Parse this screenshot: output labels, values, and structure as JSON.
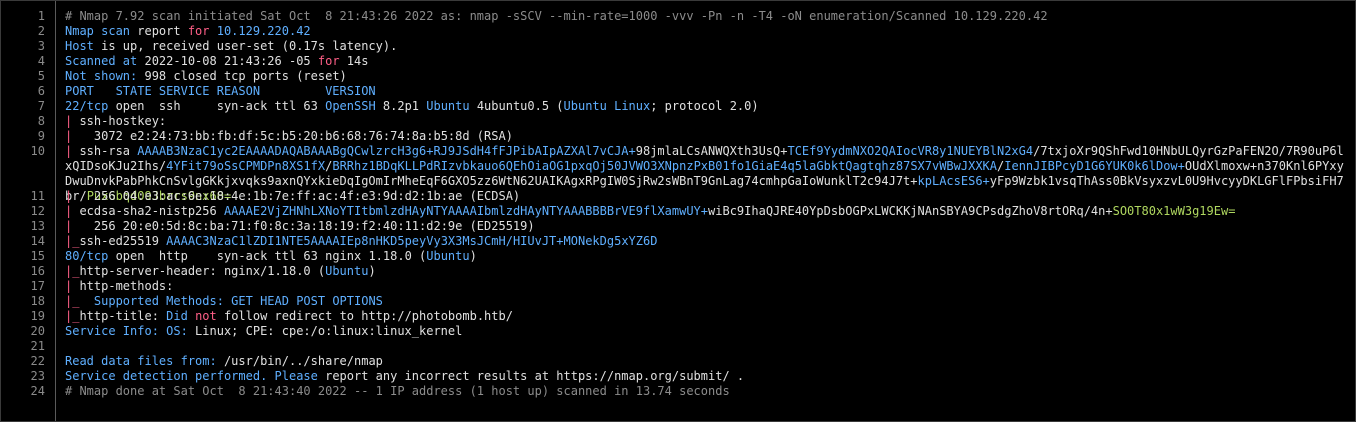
{
  "editor": {
    "lines": [
      {
        "num": "1",
        "segments": [
          {
            "text": "# Nmap 7.92 scan initiated Sat Oct  8 21:43:26 2022 as: nmap -sSCV --min-rate=1000 -vvv -Pn -n -T4 -oN enumeration/Scanned 10.129.220.42",
            "color": "#8c8c8c"
          }
        ]
      },
      {
        "num": "2",
        "segments": [
          {
            "text": "Nmap scan ",
            "color": "#5fafff"
          },
          {
            "text": "report ",
            "color": "#e0e0e0"
          },
          {
            "text": "for ",
            "color": "#ff5f87"
          },
          {
            "text": "10.129.220.42",
            "color": "#5fafff"
          }
        ]
      },
      {
        "num": "3",
        "segments": [
          {
            "text": "Host ",
            "color": "#5fafff"
          },
          {
            "text": "is up, received user-set (0.17s latency).",
            "color": "#e0e0e0"
          }
        ]
      },
      {
        "num": "4",
        "segments": [
          {
            "text": "Scanned at ",
            "color": "#5fafff"
          },
          {
            "text": "2022-10-08 21:43:26 -05 ",
            "color": "#e0e0e0"
          },
          {
            "text": "for ",
            "color": "#ff5f87"
          },
          {
            "text": "14s",
            "color": "#e0e0e0"
          }
        ]
      },
      {
        "num": "5",
        "segments": [
          {
            "text": "Not shown: ",
            "color": "#5fafff"
          },
          {
            "text": "998 closed tcp ports (reset)",
            "color": "#e0e0e0"
          }
        ]
      },
      {
        "num": "6",
        "segments": [
          {
            "text": "PORT   STATE SERVICE REASON         VERSION",
            "color": "#5fafff"
          }
        ]
      },
      {
        "num": "7",
        "segments": [
          {
            "text": "22/tcp ",
            "color": "#5fafff"
          },
          {
            "text": "open  ssh     syn-ack ttl 63 ",
            "color": "#e0e0e0"
          },
          {
            "text": "OpenSSH ",
            "color": "#5fafff"
          },
          {
            "text": "8.2p1 ",
            "color": "#e0e0e0"
          },
          {
            "text": "Ubuntu ",
            "color": "#5fafff"
          },
          {
            "text": "4ubuntu0.5 (",
            "color": "#e0e0e0"
          },
          {
            "text": "Ubuntu Linux",
            "color": "#5fafff"
          },
          {
            "text": "; protocol 2.0)",
            "color": "#e0e0e0"
          }
        ]
      },
      {
        "num": "8",
        "segments": [
          {
            "text": "| ",
            "color": "#ff5f87"
          },
          {
            "text": "ssh-hostkey:",
            "color": "#e0e0e0"
          }
        ]
      },
      {
        "num": "9",
        "segments": [
          {
            "text": "|   ",
            "color": "#ff5f87"
          },
          {
            "text": "3072 e2:24:73:bb:fb:df:5c:b5:20:b6:68:76:74:8a:b5:8d (RSA)",
            "color": "#e0e0e0"
          }
        ]
      },
      {
        "num": "10",
        "wrap": true,
        "segments": [
          {
            "text": "| ",
            "color": "#ff5f87"
          },
          {
            "text": "ssh-rsa ",
            "color": "#e0e0e0"
          },
          {
            "text": "AAAAB3NzaC1yc2EAAAADAQABAAABgQCwlzrcH3g6+RJ9JSdH4fFJPibAIpAZXAl7vCJA+",
            "color": "#5fafff"
          },
          {
            "text": "98jmlaLCsANWQXth3UsQ+",
            "color": "#e0e0e0"
          },
          {
            "text": "TCEf9YydmNXO2QAIocVR8y1NUEYBlN2xG4",
            "color": "#5fafff"
          },
          {
            "text": "/7txjoXr9QShFwd10HNbULQyrGzPaFEN2O/7R90uP6lxQIDsoKJu2Ihs/",
            "color": "#e0e0e0"
          },
          {
            "text": "4YFit79oSsCPMDPn8XS1fX",
            "color": "#5fafff"
          },
          {
            "text": "/",
            "color": "#e0e0e0"
          },
          {
            "text": "BRRhz1BDqKLLPdRIzvbkauo6QEhOiaOG1pxqOj50JVWO3XNpnzPxB01fo1GiaE4q5laGbktQagtqhz87SX7vWBwJXXKA",
            "color": "#5fafff"
          },
          {
            "text": "/",
            "color": "#e0e0e0"
          },
          {
            "text": "IennJIBPcyD1G6YUK0k6lDow+",
            "color": "#5fafff"
          },
          {
            "text": "OUdXlmoxw+n370Knl6PYxyDwuDnvkPabPhkCnSvlgGKkjxvqks9axnQYxkieDqIgOmIrMheEqF6GXO5zz6WtN62UAIKAgxRPgIW0SjRw2sWBnT9GnLag74cmhpGaIoWunklT2c94J7t+",
            "color": "#e0e0e0"
          },
          {
            "text": "kpLAcsES6+",
            "color": "#5fafff"
          },
          {
            "text": "yFp9Wzbk1vsqThAss0BkVsyxzvL0U9HvcyyDKLGFlFPbsiFH7br/",
            "color": "#e0e0e0"
          },
          {
            "text": "PuxGbqdO9Jbrrs9nx60=",
            "color": "#afd75f"
          }
        ]
      },
      {
        "num": "11",
        "segments": [
          {
            "text": "|   ",
            "color": "#ff5f87"
          },
          {
            "text": "256 04:e3:ac:6e:18:4e:1b:7e:ff:ac:4f:e3:9d:d2:1b:ae (ECDSA)",
            "color": "#e0e0e0"
          }
        ]
      },
      {
        "num": "12",
        "segments": [
          {
            "text": "| ",
            "color": "#ff5f87"
          },
          {
            "text": "ecdsa-sha2-nistp256 ",
            "color": "#e0e0e0"
          },
          {
            "text": "AAAAE2VjZHNhLXNoYTItbmlzdHAyNTYAAAAIbmlzdHAyNTYAAABBBBrVE9flXamwUY+",
            "color": "#5fafff"
          },
          {
            "text": "wiBc9IhaQJRE40YpDsbOGPxLWCKKjNAnSBYA9CPsdgZhoV8rtORq/4n+",
            "color": "#e0e0e0"
          },
          {
            "text": "SO0T80x1wW3g19Ew=",
            "color": "#afd75f"
          }
        ]
      },
      {
        "num": "13",
        "segments": [
          {
            "text": "|   ",
            "color": "#ff5f87"
          },
          {
            "text": "256 20:e0:5d:8c:ba:71:f0:8c:3a:18:19:f2:40:11:d2:9e (ED25519)",
            "color": "#e0e0e0"
          }
        ]
      },
      {
        "num": "14",
        "segments": [
          {
            "text": "|_",
            "color": "#ff5f87"
          },
          {
            "text": "ssh-ed25519 ",
            "color": "#e0e0e0"
          },
          {
            "text": "AAAAC3NzaC1lZDI1NTE5AAAAIEp8nHKD5peyVy3X3MsJCmH/HIUvJT+",
            "color": "#5fafff"
          },
          {
            "text": "MONekDg5xYZ6D",
            "color": "#5fafff"
          }
        ]
      },
      {
        "num": "15",
        "segments": [
          {
            "text": "80/tcp ",
            "color": "#5fafff"
          },
          {
            "text": "open  http    syn-ack ttl 63 nginx 1.18.0 (",
            "color": "#e0e0e0"
          },
          {
            "text": "Ubuntu",
            "color": "#5fafff"
          },
          {
            "text": ")",
            "color": "#e0e0e0"
          }
        ]
      },
      {
        "num": "16",
        "segments": [
          {
            "text": "|_",
            "color": "#ff5f87"
          },
          {
            "text": "http-server-header: nginx/1.18.0 (",
            "color": "#e0e0e0"
          },
          {
            "text": "Ubuntu",
            "color": "#5fafff"
          },
          {
            "text": ")",
            "color": "#e0e0e0"
          }
        ]
      },
      {
        "num": "17",
        "segments": [
          {
            "text": "| ",
            "color": "#ff5f87"
          },
          {
            "text": "http-methods:",
            "color": "#e0e0e0"
          }
        ]
      },
      {
        "num": "18",
        "segments": [
          {
            "text": "|_  ",
            "color": "#ff5f87"
          },
          {
            "text": "Supported Methods: GET HEAD POST OPTIONS",
            "color": "#5fafff"
          }
        ]
      },
      {
        "num": "19",
        "segments": [
          {
            "text": "|_",
            "color": "#ff5f87"
          },
          {
            "text": "http-title: ",
            "color": "#e0e0e0"
          },
          {
            "text": "Did ",
            "color": "#5fafff"
          },
          {
            "text": "not ",
            "color": "#ff5f87"
          },
          {
            "text": "follow redirect to http://photobomb.htb/",
            "color": "#e0e0e0"
          }
        ]
      },
      {
        "num": "20",
        "segments": [
          {
            "text": "Service Info: OS: ",
            "color": "#5fafff"
          },
          {
            "text": "Linux; CPE: cpe:/o:linux:linux_kernel",
            "color": "#e0e0e0"
          }
        ]
      },
      {
        "num": "21",
        "segments": []
      },
      {
        "num": "22",
        "segments": [
          {
            "text": "Read data files from: ",
            "color": "#5fafff"
          },
          {
            "text": "/usr/bin/../share/nmap",
            "color": "#e0e0e0"
          }
        ]
      },
      {
        "num": "23",
        "segments": [
          {
            "text": "Service detection performed. Please ",
            "color": "#5fafff"
          },
          {
            "text": "report any incorrect results at https://nmap.org/submit/ .",
            "color": "#e0e0e0"
          }
        ]
      },
      {
        "num": "24",
        "segments": [
          {
            "text": "# Nmap done at Sat Oct  8 21:43:40 2022 -- 1 IP address (1 host up) scanned in 13.74 seconds",
            "color": "#8c8c8c"
          }
        ]
      }
    ]
  }
}
